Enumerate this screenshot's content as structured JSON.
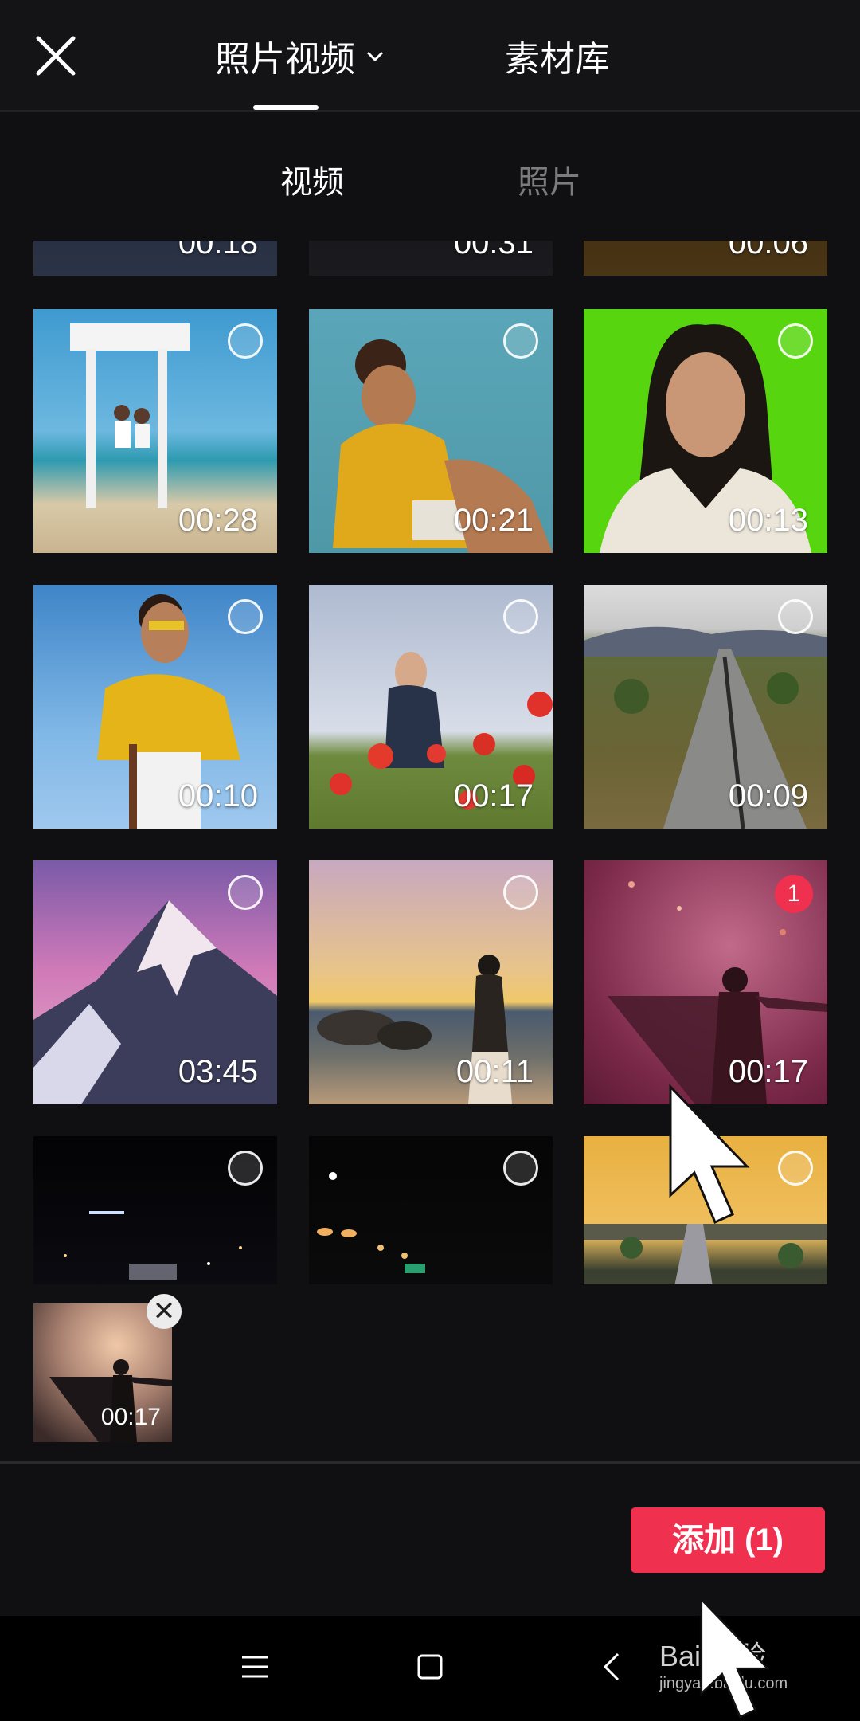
{
  "header": {
    "tabs": [
      {
        "label": "照片视频"
      },
      {
        "label": "素材库"
      }
    ]
  },
  "subtabs": [
    {
      "label": "视频",
      "active": true
    },
    {
      "label": "照片",
      "active": false
    }
  ],
  "grid": {
    "partial_row": [
      "00:18",
      "00:31",
      "00:06"
    ],
    "items": [
      {
        "duration": "00:28"
      },
      {
        "duration": "00:21"
      },
      {
        "duration": "00:13"
      },
      {
        "duration": "00:10"
      },
      {
        "duration": "00:17"
      },
      {
        "duration": "00:09"
      },
      {
        "duration": "03:45"
      },
      {
        "duration": "00:11"
      },
      {
        "duration": "00:17",
        "selected_index": "1"
      }
    ]
  },
  "selected_tray": {
    "items": [
      {
        "duration": "00:17"
      }
    ]
  },
  "footer": {
    "add_label": "添加 (1)"
  },
  "watermark": {
    "brand": "Bai 经验",
    "url": "jingyan.baidu.com"
  },
  "colors": {
    "accent": "#f0304f",
    "background": "#101012"
  },
  "icons": [
    "close-icon",
    "chevron-down-icon",
    "remove-icon",
    "menu-icon",
    "home-icon",
    "back-icon"
  ]
}
